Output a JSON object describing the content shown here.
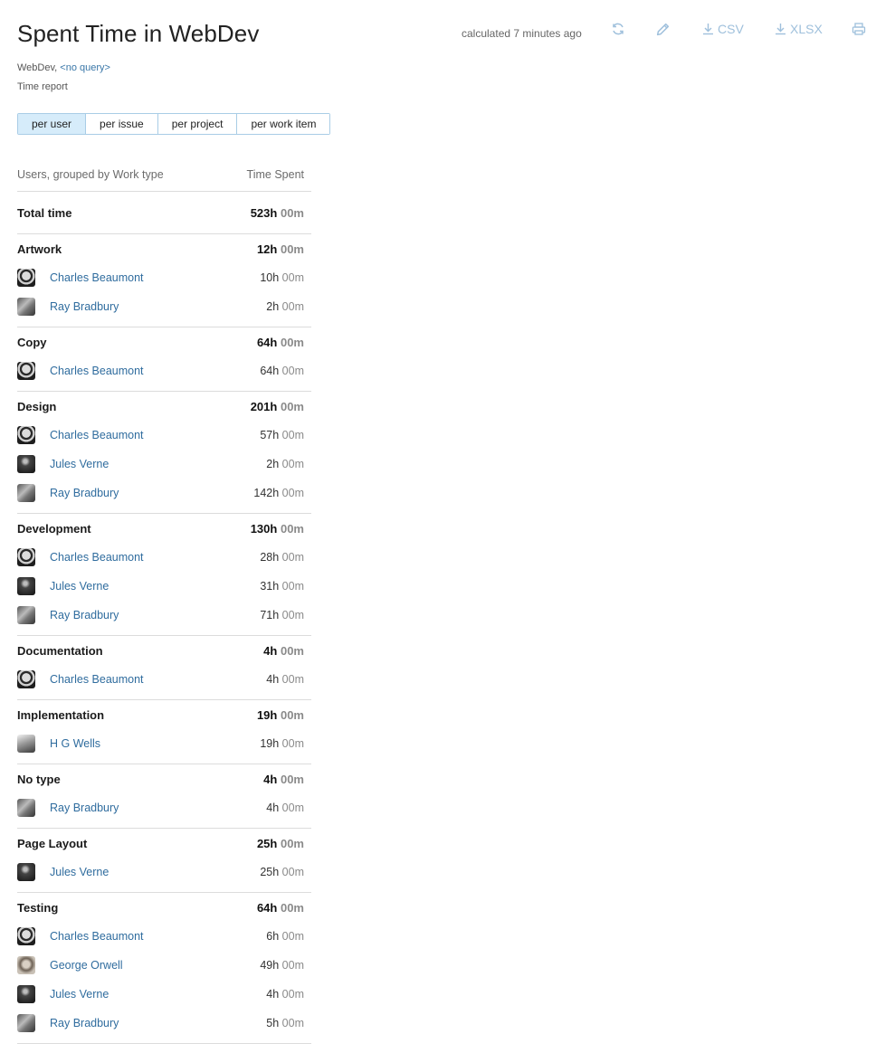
{
  "page": {
    "title": "Spent Time in WebDev",
    "calculated": "calculated 7 minutes ago",
    "context_project": "WebDev,",
    "context_query": "<no query>",
    "report_type": "Time report"
  },
  "toolbar": {
    "refresh_icon": "refresh-icon",
    "edit_icon": "pencil-icon",
    "csv_label": "CSV",
    "xlsx_label": "XLSX",
    "print_icon": "printer-icon",
    "icon_color": "#9fc0dc"
  },
  "tabs": [
    {
      "label": "per user",
      "active": true
    },
    {
      "label": "per issue",
      "active": false
    },
    {
      "label": "per project",
      "active": false
    },
    {
      "label": "per work item",
      "active": false
    }
  ],
  "report": {
    "column_group": "Users, grouped by Work type",
    "column_time": "Time Spent",
    "total_label": "Total time",
    "total_hours": "523h",
    "total_minutes": "00m",
    "groups": [
      {
        "name": "Artwork",
        "hours": "12h",
        "minutes": "00m",
        "users": [
          {
            "name": "Charles Beaumont",
            "avatar": "charles",
            "hours": "10h",
            "minutes": "00m"
          },
          {
            "name": "Ray Bradbury",
            "avatar": "ray",
            "hours": "2h",
            "minutes": "00m"
          }
        ]
      },
      {
        "name": "Copy",
        "hours": "64h",
        "minutes": "00m",
        "users": [
          {
            "name": "Charles Beaumont",
            "avatar": "charles",
            "hours": "64h",
            "minutes": "00m"
          }
        ]
      },
      {
        "name": "Design",
        "hours": "201h",
        "minutes": "00m",
        "users": [
          {
            "name": "Charles Beaumont",
            "avatar": "charles",
            "hours": "57h",
            "minutes": "00m"
          },
          {
            "name": "Jules Verne",
            "avatar": "jules",
            "hours": "2h",
            "minutes": "00m"
          },
          {
            "name": "Ray Bradbury",
            "avatar": "ray",
            "hours": "142h",
            "minutes": "00m"
          }
        ]
      },
      {
        "name": "Development",
        "hours": "130h",
        "minutes": "00m",
        "users": [
          {
            "name": "Charles Beaumont",
            "avatar": "charles",
            "hours": "28h",
            "minutes": "00m"
          },
          {
            "name": "Jules Verne",
            "avatar": "jules",
            "hours": "31h",
            "minutes": "00m"
          },
          {
            "name": "Ray Bradbury",
            "avatar": "ray",
            "hours": "71h",
            "minutes": "00m"
          }
        ]
      },
      {
        "name": "Documentation",
        "hours": "4h",
        "minutes": "00m",
        "users": [
          {
            "name": "Charles Beaumont",
            "avatar": "charles",
            "hours": "4h",
            "minutes": "00m"
          }
        ]
      },
      {
        "name": "Implementation",
        "hours": "19h",
        "minutes": "00m",
        "users": [
          {
            "name": "H G Wells",
            "avatar": "hg",
            "hours": "19h",
            "minutes": "00m"
          }
        ]
      },
      {
        "name": "No type",
        "hours": "4h",
        "minutes": "00m",
        "users": [
          {
            "name": "Ray Bradbury",
            "avatar": "ray",
            "hours": "4h",
            "minutes": "00m"
          }
        ]
      },
      {
        "name": "Page Layout",
        "hours": "25h",
        "minutes": "00m",
        "users": [
          {
            "name": "Jules Verne",
            "avatar": "jules",
            "hours": "25h",
            "minutes": "00m"
          }
        ]
      },
      {
        "name": "Testing",
        "hours": "64h",
        "minutes": "00m",
        "users": [
          {
            "name": "Charles Beaumont",
            "avatar": "charles",
            "hours": "6h",
            "minutes": "00m"
          },
          {
            "name": "George Orwell",
            "avatar": "george",
            "hours": "49h",
            "minutes": "00m"
          },
          {
            "name": "Jules Verne",
            "avatar": "jules",
            "hours": "4h",
            "minutes": "00m"
          },
          {
            "name": "Ray Bradbury",
            "avatar": "ray",
            "hours": "5h",
            "minutes": "00m"
          }
        ]
      }
    ]
  },
  "colors": {
    "link": "#2f6c9e",
    "tab_active_bg": "#d6ecfa",
    "tab_border": "#a9cde6"
  }
}
